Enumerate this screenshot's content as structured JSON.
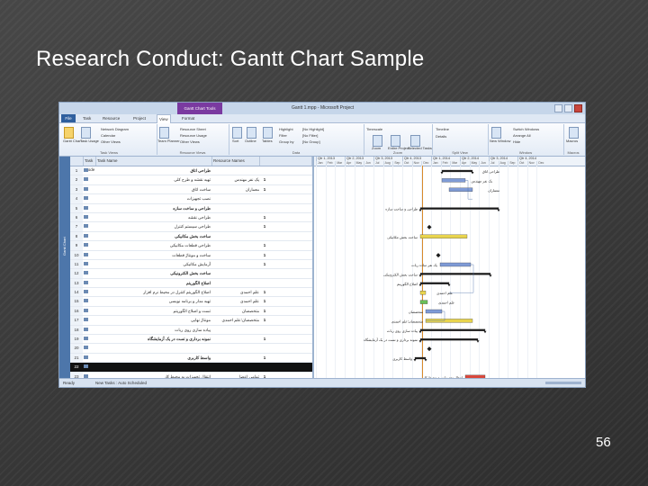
{
  "slide": {
    "title": "Research Conduct: Gantt Chart Sample",
    "page_number": "56"
  },
  "window": {
    "title": "Gantt 1.mpp - Microsoft Project",
    "context_tab": "Gantt Chart Tools",
    "tabs": [
      "File",
      "Task",
      "Resource",
      "Project",
      "View",
      "Format"
    ],
    "active_tab": "View"
  },
  "ribbon": {
    "groups": [
      {
        "label": "Task Views",
        "items": [
          "Gantt Chart",
          "Task Usage",
          "Network Diagram",
          "Calendar",
          "Other Views"
        ]
      },
      {
        "label": "Resource Views",
        "items": [
          "Team Planner",
          "Resource Sheet",
          "Resource Usage",
          "Other Views"
        ]
      },
      {
        "label": "Data",
        "items": [
          "Sort",
          "Outline",
          "Tables",
          "Highlight",
          "Filter",
          "Group by",
          "[No Highlight]",
          "[No Filter]",
          "[No Group]"
        ]
      },
      {
        "label": "Zoom",
        "items": [
          "Timescale",
          "Zoom",
          "Entire Project",
          "Selected Tasks"
        ]
      },
      {
        "label": "Split View",
        "items": [
          "Timeline",
          "Details"
        ]
      },
      {
        "label": "Window",
        "items": [
          "New Window",
          "Switch Windows",
          "Arrange All",
          "Hide"
        ]
      },
      {
        "label": "Macros",
        "items": [
          "Macros"
        ]
      }
    ]
  },
  "sidebar": {
    "label": "Gantt Chart"
  },
  "table": {
    "columns": [
      "Task Mode",
      "Task Name",
      "Resource Names"
    ],
    "rows": [
      {
        "id": "1",
        "name": "طراحی اتاق",
        "resource": "",
        "flag": "",
        "summary": true
      },
      {
        "id": "2",
        "name": "تهیه نقشه و طرح کلی",
        "resource": "یک نفر مهندس",
        "flag": "1",
        "summary": false
      },
      {
        "id": "3",
        "name": "ساخت اتاق",
        "resource": "معماران",
        "flag": "1",
        "summary": false
      },
      {
        "id": "4",
        "name": "نصب تجهیزات",
        "resource": "",
        "flag": "",
        "summary": false
      },
      {
        "id": "5",
        "name": "طراحی و ساخت سازه",
        "resource": "",
        "flag": "",
        "summary": true
      },
      {
        "id": "6",
        "name": "طراحی نقشه",
        "resource": "",
        "flag": "1",
        "summary": false
      },
      {
        "id": "7",
        "name": "طراحی سیستم کنترل",
        "resource": "",
        "flag": "1",
        "summary": false
      },
      {
        "id": "8",
        "name": "ساخت بخش مکانیکی",
        "resource": "",
        "flag": "",
        "summary": true
      },
      {
        "id": "9",
        "name": "طراحی قطعات مکانیکی",
        "resource": "",
        "flag": "1",
        "summary": false
      },
      {
        "id": "10",
        "name": "ساخت و مونتاژ قطعات",
        "resource": "",
        "flag": "1",
        "summary": false
      },
      {
        "id": "11",
        "name": "آزمایش مکانیکی",
        "resource": "",
        "flag": "1",
        "summary": false
      },
      {
        "id": "12",
        "name": "ساخت بخش الکترونیکی",
        "resource": "",
        "flag": "",
        "summary": true
      },
      {
        "id": "13",
        "name": "اصلاح الگوریتم",
        "resource": "",
        "flag": "",
        "summary": true
      },
      {
        "id": "14",
        "name": "اصلاح الگوریتم کنترل در محیط نرم افزار",
        "resource": "علم احمدی",
        "flag": "1",
        "summary": false
      },
      {
        "id": "15",
        "name": "تهیه مدار و برنامه نویسی",
        "resource": "علم احمدی",
        "flag": "1",
        "summary": false
      },
      {
        "id": "16",
        "name": "تست و اصلاح الگوریتم",
        "resource": "متخصصان",
        "flag": "1",
        "summary": false
      },
      {
        "id": "17",
        "name": "مونتاژ نهایی",
        "resource": "متخصصان؛علم احمدی",
        "flag": "1",
        "summary": false
      },
      {
        "id": "18",
        "name": "پیاده سازی روی ربات",
        "resource": "",
        "flag": "",
        "summary": false
      },
      {
        "id": "19",
        "name": "نمونه برداری و تست در یک آزمایشگاه",
        "resource": "",
        "flag": "1",
        "summary": true
      },
      {
        "id": "20",
        "name": "",
        "resource": "",
        "flag": "",
        "summary": false
      },
      {
        "id": "21",
        "name": "واسط کاربری",
        "resource": "",
        "flag": "1",
        "summary": true
      },
      {
        "id": "22",
        "name": "",
        "resource": "",
        "flag": "",
        "summary": false,
        "selected": true
      },
      {
        "id": "23",
        "name": "انتقال تجهیزات به محیط کار",
        "resource": "تمامی اعضا",
        "flag": "1",
        "summary": false
      },
      {
        "id": "24",
        "name": "انتقال و راه اندازی",
        "resource": "",
        "flag": "",
        "summary": false
      }
    ]
  },
  "gantt": {
    "quarters": [
      "Qtr 1, 2013",
      "Qtr 2, 2013",
      "Qtr 3, 2013",
      "Qtr 4, 2013",
      "Qtr 1, 2014",
      "Qtr 2, 2014",
      "Qtr 3, 2014",
      "Qtr 4, 2014"
    ],
    "months": [
      "Jan",
      "Feb",
      "Mar",
      "Apr",
      "May",
      "Jun",
      "Jul",
      "Aug",
      "Sep",
      "Oct",
      "Nov",
      "Dec",
      "Jan",
      "Feb",
      "Mar",
      "Apr",
      "May",
      "Jun",
      "Jul",
      "Aug",
      "Sep",
      "Oct",
      "Nov",
      "Dec"
    ],
    "bar_labels": [
      "طراحی اتاق",
      "یک نفر مهندس",
      "معماران",
      "طراحی و ساخت سازه",
      "ساخت بخش مکانیکی",
      "یک نفر ساده ربات",
      "ساخت بخش الکترونیکی",
      "اصلاح الگوریتم",
      "علم احمدی",
      "علم احمدی",
      "متخصصان",
      "متخصصان؛علم احمدی",
      "پیاده سازی روی ربات",
      "نمونه برداری و تست در یک آزمایشگاه",
      "واسط کاربری",
      "انتقال تجهیزات به محیط کار",
      "انتقال و راه اندازی"
    ],
    "colors": {
      "task_bar": "#7f9bd6",
      "summary_bar": "#1a1a1a",
      "yellow": "#e8d44d",
      "green": "#6bbf59",
      "red": "#d9473b",
      "critical_line": "#d88a2a"
    }
  },
  "status": {
    "ready": "Ready",
    "new_tasks": "New Tasks : Auto Scheduled"
  }
}
